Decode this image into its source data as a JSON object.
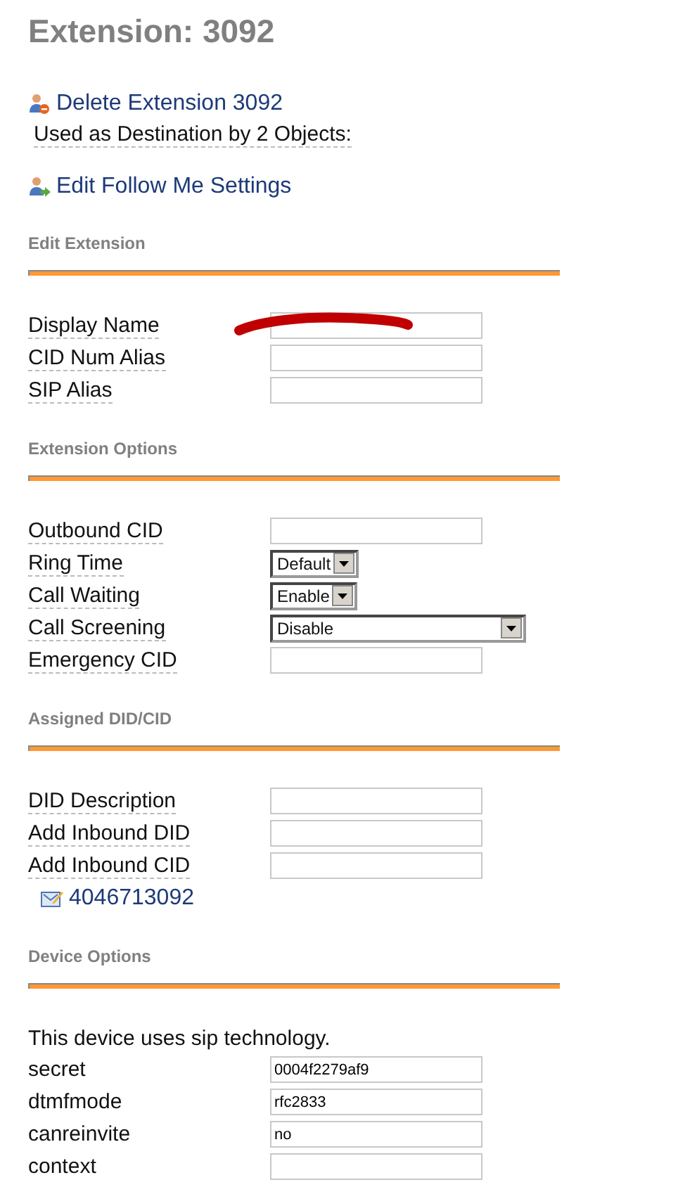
{
  "title": "Extension: 3092",
  "delete_link": {
    "label": "Delete Extension 3092"
  },
  "usage_note": "Used as Destination by 2 Objects:",
  "follow_me_link": {
    "label": "Edit Follow Me Settings"
  },
  "sections": [
    {
      "heading": "Edit Extension",
      "rows": [
        {
          "kind": "text",
          "label": "Display Name",
          "help": true,
          "redacted": true
        },
        {
          "kind": "text",
          "label": "CID Num Alias",
          "help": true,
          "redacted": false
        },
        {
          "kind": "text",
          "label": "SIP Alias",
          "help": true,
          "redacted": false
        }
      ]
    },
    {
      "heading": "Extension Options",
      "rows": [
        {
          "kind": "text",
          "label": "Outbound CID",
          "help": true,
          "redacted": false
        },
        {
          "kind": "dropdown",
          "label": "Ring Time",
          "help": true,
          "value": "Default"
        },
        {
          "kind": "dropdown",
          "label": "Call Waiting",
          "help": true,
          "value": "Enable"
        },
        {
          "kind": "long-dropdown",
          "label": "Call Screening",
          "help": true,
          "value": "Disable"
        },
        {
          "kind": "text",
          "label": "Emergency CID",
          "help": true,
          "redacted": false
        }
      ]
    },
    {
      "heading": "Assigned DID/CID",
      "rows": [
        {
          "kind": "text",
          "label": "DID Description",
          "help": true,
          "redacted": false
        },
        {
          "kind": "text",
          "label": "Add Inbound DID",
          "help": true,
          "redacted": false
        },
        {
          "kind": "text",
          "label": "Add Inbound CID",
          "help": true,
          "redacted": false
        },
        {
          "kind": "did-link",
          "label": "4046713092"
        }
      ]
    },
    {
      "heading": "Device Options",
      "intro": "This device uses sip technology.",
      "rows": [
        {
          "kind": "text",
          "label": "secret",
          "help": false,
          "redacted": false,
          "value": "0004f2279af9"
        },
        {
          "kind": "text",
          "label": "dtmfmode",
          "help": false,
          "redacted": false,
          "value": "rfc2833"
        },
        {
          "kind": "text",
          "label": "canreinvite",
          "help": false,
          "redacted": false,
          "value": "no"
        },
        {
          "kind": "text",
          "label": "context",
          "help": false,
          "redacted": false
        }
      ]
    }
  ]
}
